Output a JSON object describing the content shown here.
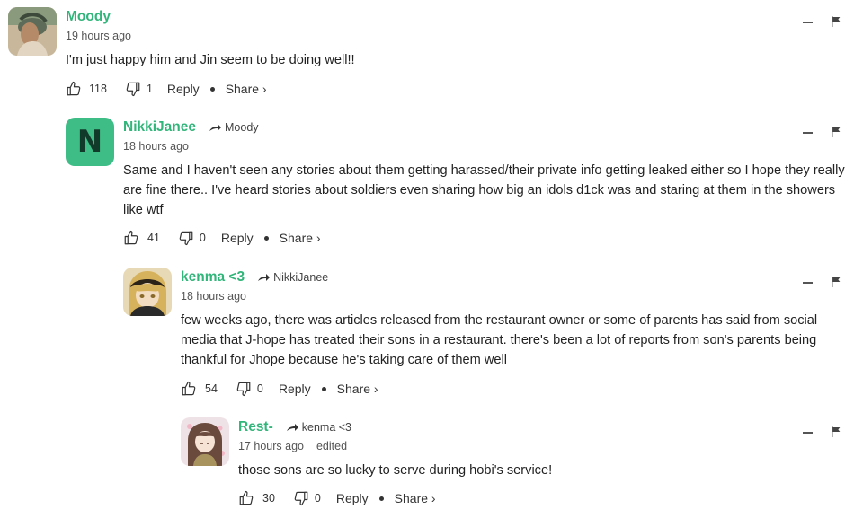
{
  "comments": [
    {
      "author": "Moody",
      "reply_to": "",
      "time": "19 hours ago",
      "edited": "",
      "text": "I'm just happy him and Jin seem to be doing well!!",
      "likes": "118",
      "dislikes": "1",
      "reply_label": "Reply",
      "share_label": "Share ›",
      "avatar_icon": "photo-avatar-icon"
    },
    {
      "author": "NikkiJanee",
      "reply_to": "Moody",
      "time": "18 hours ago",
      "edited": "",
      "text": "Same and I haven't seen any stories about them getting harassed/their private info getting leaked either so I hope they really are fine there.. I've heard stories about soldiers even sharing how big an idols d1ck was and staring at them in the showers like wtf",
      "likes": "41",
      "dislikes": "0",
      "reply_label": "Reply",
      "share_label": "Share ›",
      "avatar_letter": "N",
      "avatar_color": "#3ebd87"
    },
    {
      "author": "kenma <3",
      "reply_to": "NikkiJanee",
      "time": "18 hours ago",
      "edited": "",
      "text": "few weeks ago, there was articles released from the restaurant owner or some of parents has said from social media that J-hope has treated their sons in a restaurant. there's been a lot of reports from son's parents being thankful for Jhope because he's taking care of them well",
      "likes": "54",
      "dislikes": "0",
      "reply_label": "Reply",
      "share_label": "Share ›",
      "avatar_icon": "anime-avatar-icon"
    },
    {
      "author": "Rest-",
      "reply_to": "kenma <3",
      "time": "17 hours ago",
      "edited": "edited",
      "text": "those sons are so lucky to serve during hobi's service!",
      "likes": "30",
      "dislikes": "0",
      "reply_label": "Reply",
      "share_label": "Share ›",
      "avatar_icon": "anime-girl-avatar-icon"
    }
  ],
  "colors": {
    "author": "#31b57a",
    "text": "#222222",
    "meta": "#555555"
  }
}
